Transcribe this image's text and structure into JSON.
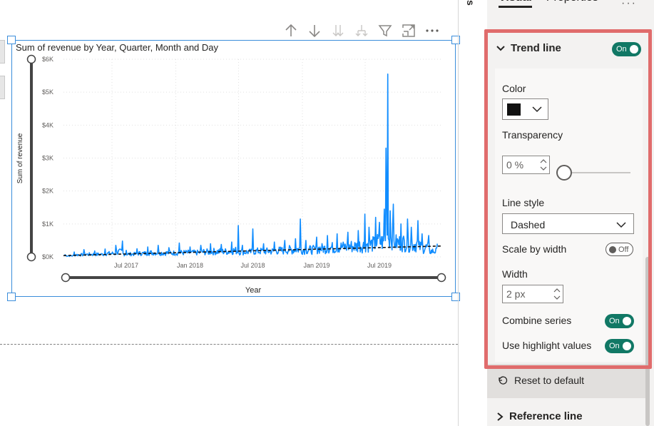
{
  "pane": {
    "tabs": [
      {
        "label": "Visual",
        "active": true
      },
      {
        "label": "Properties",
        "active": false
      }
    ],
    "collapsed_label": "s",
    "more_label": "···"
  },
  "visual_header_icons": [
    "arrow-up-icon",
    "arrow-down-icon",
    "double-arrow-down-icon",
    "expand-hierarchy-icon",
    "filter-icon",
    "focus-mode-icon",
    "more-options-icon"
  ],
  "trend_line": {
    "title": "Trend line",
    "toggle": "On",
    "color_label": "Color",
    "color_value": "#111111",
    "transparency_label": "Transparency",
    "transparency_value": "0 %",
    "transparency_pct": 0,
    "line_style_label": "Line style",
    "line_style_value": "Dashed",
    "scale_by_width_label": "Scale by width",
    "scale_by_width_toggle": "Off",
    "width_label": "Width",
    "width_value": "2 px",
    "combine_series_label": "Combine series",
    "combine_series_toggle": "On",
    "use_highlight_label": "Use highlight values",
    "use_highlight_toggle": "On"
  },
  "reset_label": "Reset to default",
  "reference_line_label": "Reference line",
  "colors": {
    "accent_toggle": "#117865",
    "series_line": "#118dff",
    "highlight_border": "#e06c6c",
    "selection_border": "#3a8ddb"
  },
  "chart_data": {
    "type": "line",
    "title": "Sum of revenue by Year, Quarter, Month and Day",
    "xlabel": "Year",
    "ylabel": "Sum of revenue",
    "y_ticks": [
      "$0K",
      "$1K",
      "$2K",
      "$3K",
      "$4K",
      "$5K",
      "$6K"
    ],
    "x_ticks": [
      "Jul 2017",
      "Jan 2018",
      "Jul 2018",
      "Jan 2019",
      "Jul 2019"
    ],
    "ylim": [
      0,
      6000
    ],
    "xlim": [
      "2017-01-01",
      "2019-12-31"
    ],
    "grid": true,
    "series": [
      {
        "values_sampled": {
          "dates": [
            "2017-01-05",
            "2017-02-01",
            "2017-03-01",
            "2017-04-01",
            "2017-05-01",
            "2017-06-01",
            "2017-06-20",
            "2017-07-01",
            "2017-08-01",
            "2017-09-01",
            "2017-10-01",
            "2017-11-01",
            "2017-12-01",
            "2018-01-01",
            "2018-02-01",
            "2018-03-01",
            "2018-04-01",
            "2018-05-01",
            "2018-05-20",
            "2018-06-01",
            "2018-07-01",
            "2018-08-01",
            "2018-09-01",
            "2018-10-01",
            "2018-11-01",
            "2018-11-15",
            "2018-12-01",
            "2019-01-01",
            "2019-02-01",
            "2019-03-01",
            "2019-04-01",
            "2019-05-01",
            "2019-05-20",
            "2019-06-01",
            "2019-06-20",
            "2019-07-01",
            "2019-07-15",
            "2019-07-20",
            "2019-07-25",
            "2019-08-01",
            "2019-08-10",
            "2019-09-01",
            "2019-09-20",
            "2019-10-01",
            "2019-10-20",
            "2019-11-01",
            "2019-11-20",
            "2019-12-15"
          ],
          "values": [
            80,
            150,
            220,
            180,
            240,
            350,
            480,
            200,
            250,
            300,
            350,
            280,
            420,
            300,
            350,
            400,
            380,
            450,
            950,
            350,
            850,
            400,
            450,
            500,
            550,
            1150,
            500,
            600,
            650,
            700,
            750,
            800,
            1300,
            900,
            1200,
            1050,
            1450,
            3300,
            5550,
            1400,
            1600,
            1000,
            1150,
            900,
            1100,
            700,
            650,
            400
          ]
        }
      }
    ],
    "trend_line": {
      "start": 40,
      "end": 330,
      "style": "dashed",
      "color": "#111111"
    }
  }
}
